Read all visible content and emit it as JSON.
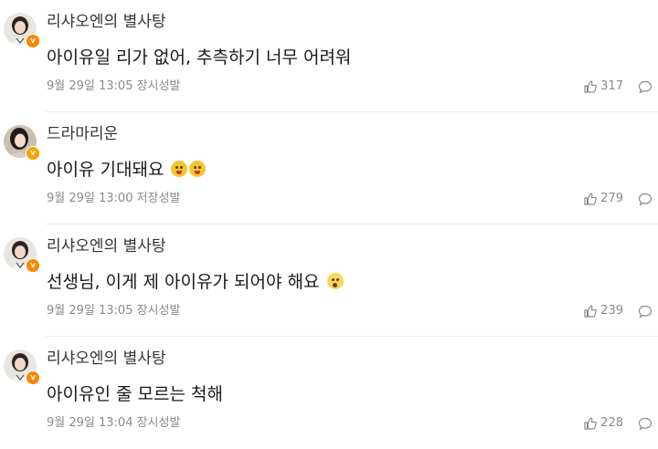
{
  "comments": [
    {
      "username": "리샤오엔의 별사탕",
      "text": "아이유일 리가 없어, 추측하기 너무 어려워",
      "emojis": [],
      "meta": "9월 29일 13:05 장시성발",
      "likes": "317",
      "badge": "orange",
      "avatar_color": "#d9d4cf"
    },
    {
      "username": "드라마리운",
      "text": "아이유 기대돼요",
      "emojis": [
        "excited-face",
        "excited-face"
      ],
      "meta": "9월 29일 13:00 저장성발",
      "likes": "279",
      "badge": "yellow",
      "avatar_color": "#cfc3b8"
    },
    {
      "username": "리샤오엔의 별사탕",
      "text": "선생님, 이게 제 아이유가 되어야 해요",
      "emojis": [
        "shocked-face"
      ],
      "meta": "9월 29일 13:05 장시성발",
      "likes": "239",
      "badge": "orange",
      "avatar_color": "#d9d4cf"
    },
    {
      "username": "리샤오엔의 별사탕",
      "text": "아이유인 줄 모르는 척해",
      "emojis": [],
      "meta": "9월 29일 13:04 장시성발",
      "likes": "228",
      "badge": "orange",
      "avatar_color": "#d9d4cf"
    }
  ],
  "icons": {
    "like": "thumbs-up-icon",
    "reply": "comment-bubble-icon",
    "badge": "verified-v-icon"
  }
}
